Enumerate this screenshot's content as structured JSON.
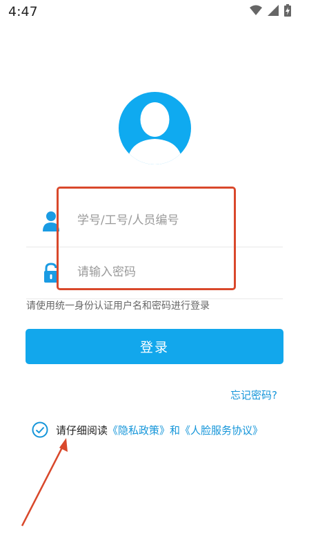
{
  "status_bar": {
    "time": "4:47"
  },
  "form": {
    "username_placeholder": "学号/工号/人员编号",
    "password_placeholder": "请输入密码",
    "hint": "请使用统一身份认证用户名和密码进行登录",
    "login_label": "登录",
    "forgot_label": "忘记密码?"
  },
  "agreement": {
    "prefix": "请仔细阅读",
    "privacy_link": "《隐私政策》",
    "connector": "和",
    "face_link": "《人脸服务协议》"
  },
  "colors": {
    "accent": "#12a7ec",
    "link": "#1495d9",
    "annotation": "#d9482b"
  }
}
